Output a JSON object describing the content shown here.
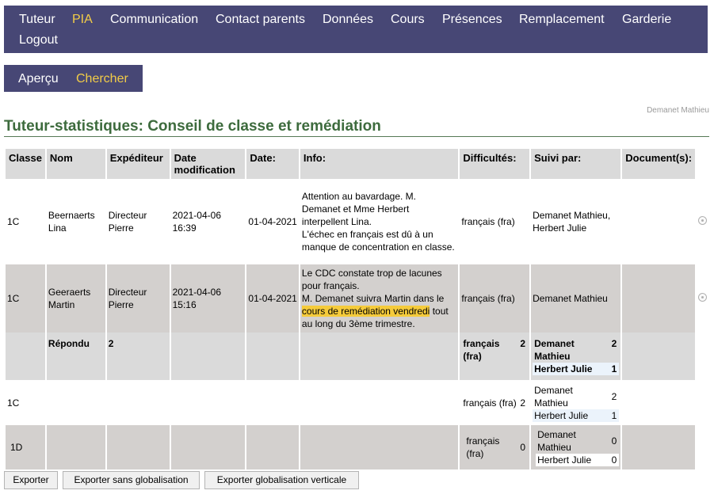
{
  "nav": {
    "items": [
      "Tuteur",
      "PIA",
      "Communication",
      "Contact parents",
      "Données",
      "Cours",
      "Présences",
      "Remplacement",
      "Garderie",
      "Logout"
    ]
  },
  "subnav": {
    "items": [
      "Aperçu",
      "Chercher"
    ]
  },
  "user_name": "Demanet Mathieu",
  "page_title": "Tuteur-statistiques: Conseil de classe et remédiation",
  "table": {
    "headers": [
      "Classe",
      "Nom",
      "Expéditeur",
      "Date modification",
      "Date:",
      "Info:",
      "Difficultés:",
      "Suivi par:",
      "Document(s):"
    ],
    "rows": [
      {
        "classe": "1C",
        "nom": "Beernaerts Lina",
        "expediteur": "Directeur Pierre",
        "date_mod": "2021-04-06 16:39",
        "date": "01-04-2021",
        "info_line1": "Attention au bavardage. M. Demanet et Mme Herbert interpellent Lina.",
        "info_line2": "L'échec en français est dû à un manque de concentration en classe.",
        "difficultes": "français (fra)",
        "suivi": "Demanet Mathieu, Herbert Julie"
      },
      {
        "classe": "1C",
        "nom": "Geeraerts Martin",
        "expediteur": "Directeur Pierre",
        "date_mod": "2021-04-06 15:16",
        "date": "01-04-2021",
        "info_line1": "Le CDC constate trop de lacunes pour français.",
        "info_line2_pre": "M. Demanet suivra Martin dans le",
        "info_line2_hl": "cours de remédiation vendredi",
        "info_line2_post": "tout au long du 3ème trimestre.",
        "difficultes": "français (fra)",
        "suivi": "Demanet Mathieu"
      }
    ],
    "summary": {
      "label": "Répondu",
      "count": "2",
      "difficulty": "français (fra)",
      "difficulty_count": "2",
      "suivi": [
        {
          "name": "Demanet Mathieu",
          "count": "2"
        },
        {
          "name": "Herbert Julie",
          "count": "1"
        }
      ]
    },
    "class_rows": [
      {
        "classe": "1C",
        "difficulty": "français (fra)",
        "difficulty_count": "2",
        "suivi": [
          {
            "name": "Demanet Mathieu",
            "count": "2"
          },
          {
            "name": "Herbert Julie",
            "count": "1"
          }
        ]
      },
      {
        "classe": "1D",
        "difficulty": "français (fra)",
        "difficulty_count": "0",
        "suivi": [
          {
            "name": "Demanet Mathieu",
            "count": "0"
          },
          {
            "name": "Herbert Julie",
            "count": "0"
          }
        ]
      }
    ]
  },
  "buttons": [
    "Exporter",
    "Exporter sans globalisation",
    "Exporter globalisation verticale"
  ],
  "colors": {
    "nav_bg": "#474775",
    "nav_active": "#f2cc47",
    "title": "#3d6b3d",
    "highlight": "#f5cb3b",
    "row_alt": "#d3d0ce"
  }
}
